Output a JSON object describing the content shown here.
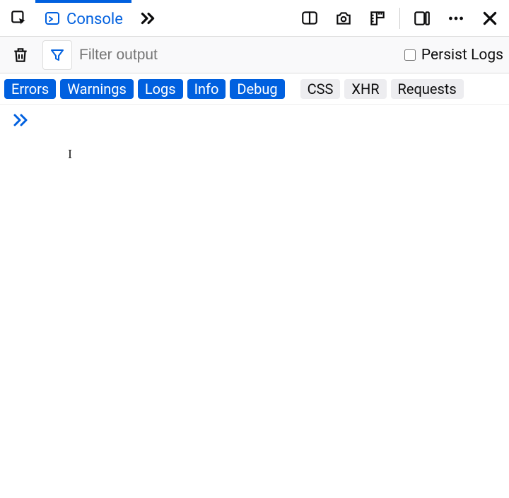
{
  "tabs": {
    "console_label": "Console"
  },
  "filter": {
    "placeholder": "Filter output",
    "persist_label": "Persist Logs"
  },
  "chips": {
    "errors": "Errors",
    "warnings": "Warnings",
    "logs": "Logs",
    "info": "Info",
    "debug": "Debug",
    "css": "CSS",
    "xhr": "XHR",
    "requests": "Requests"
  }
}
